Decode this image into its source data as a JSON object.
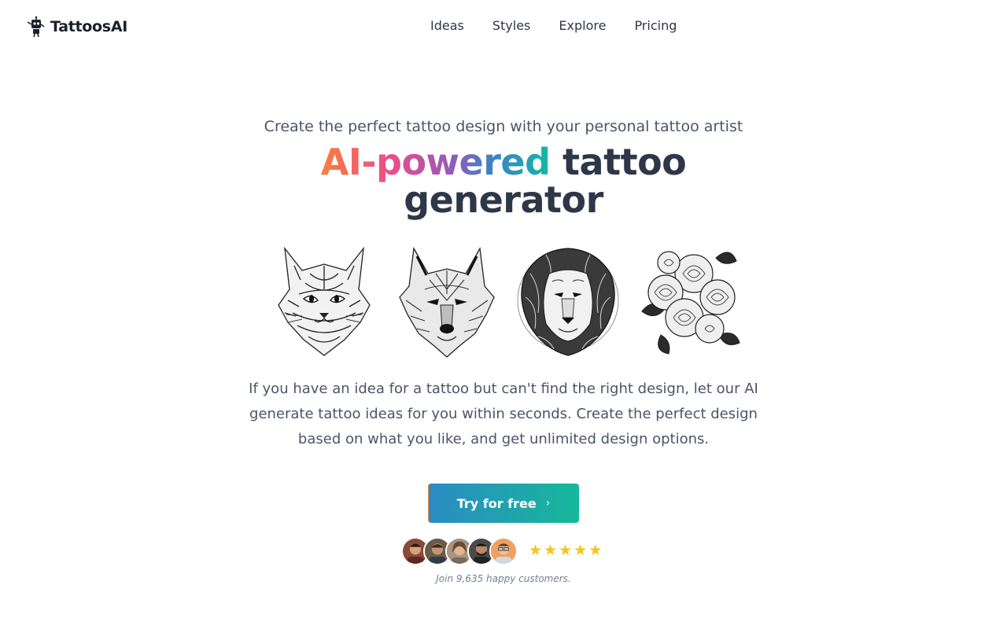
{
  "brand": {
    "name": "TattoosAI",
    "logo_icon": "robot-icon"
  },
  "nav": {
    "items": [
      "Ideas",
      "Styles",
      "Explore",
      "Pricing"
    ]
  },
  "hero": {
    "subtitle": "Create the perfect tattoo design with your personal tattoo artist",
    "headline_gradient": "AI-powered",
    "headline_rest": " tattoo generator",
    "gradient_colors": [
      "#f6803f",
      "#ec4c8b",
      "#9b59b6",
      "#3b82c4",
      "#14b8a6"
    ],
    "description": "If you have an idea for a tattoo but can't find the right design, let our AI generate tattoo ideas for you within seconds. Create the perfect design based on what you like, and get unlimited design options."
  },
  "gallery": [
    {
      "name": "cat-tattoo-image"
    },
    {
      "name": "wolf-tattoo-image"
    },
    {
      "name": "lion-tattoo-image"
    },
    {
      "name": "roses-tattoo-image"
    }
  ],
  "cta": {
    "label": "Try for free",
    "icon": "chevron-right-icon",
    "colors": [
      "#2b8bc4",
      "#17b89a"
    ]
  },
  "social_proof": {
    "rating": 5,
    "rating_max": 5,
    "star_color": "#f5c518",
    "caption": "Join 9,635 happy customers."
  }
}
